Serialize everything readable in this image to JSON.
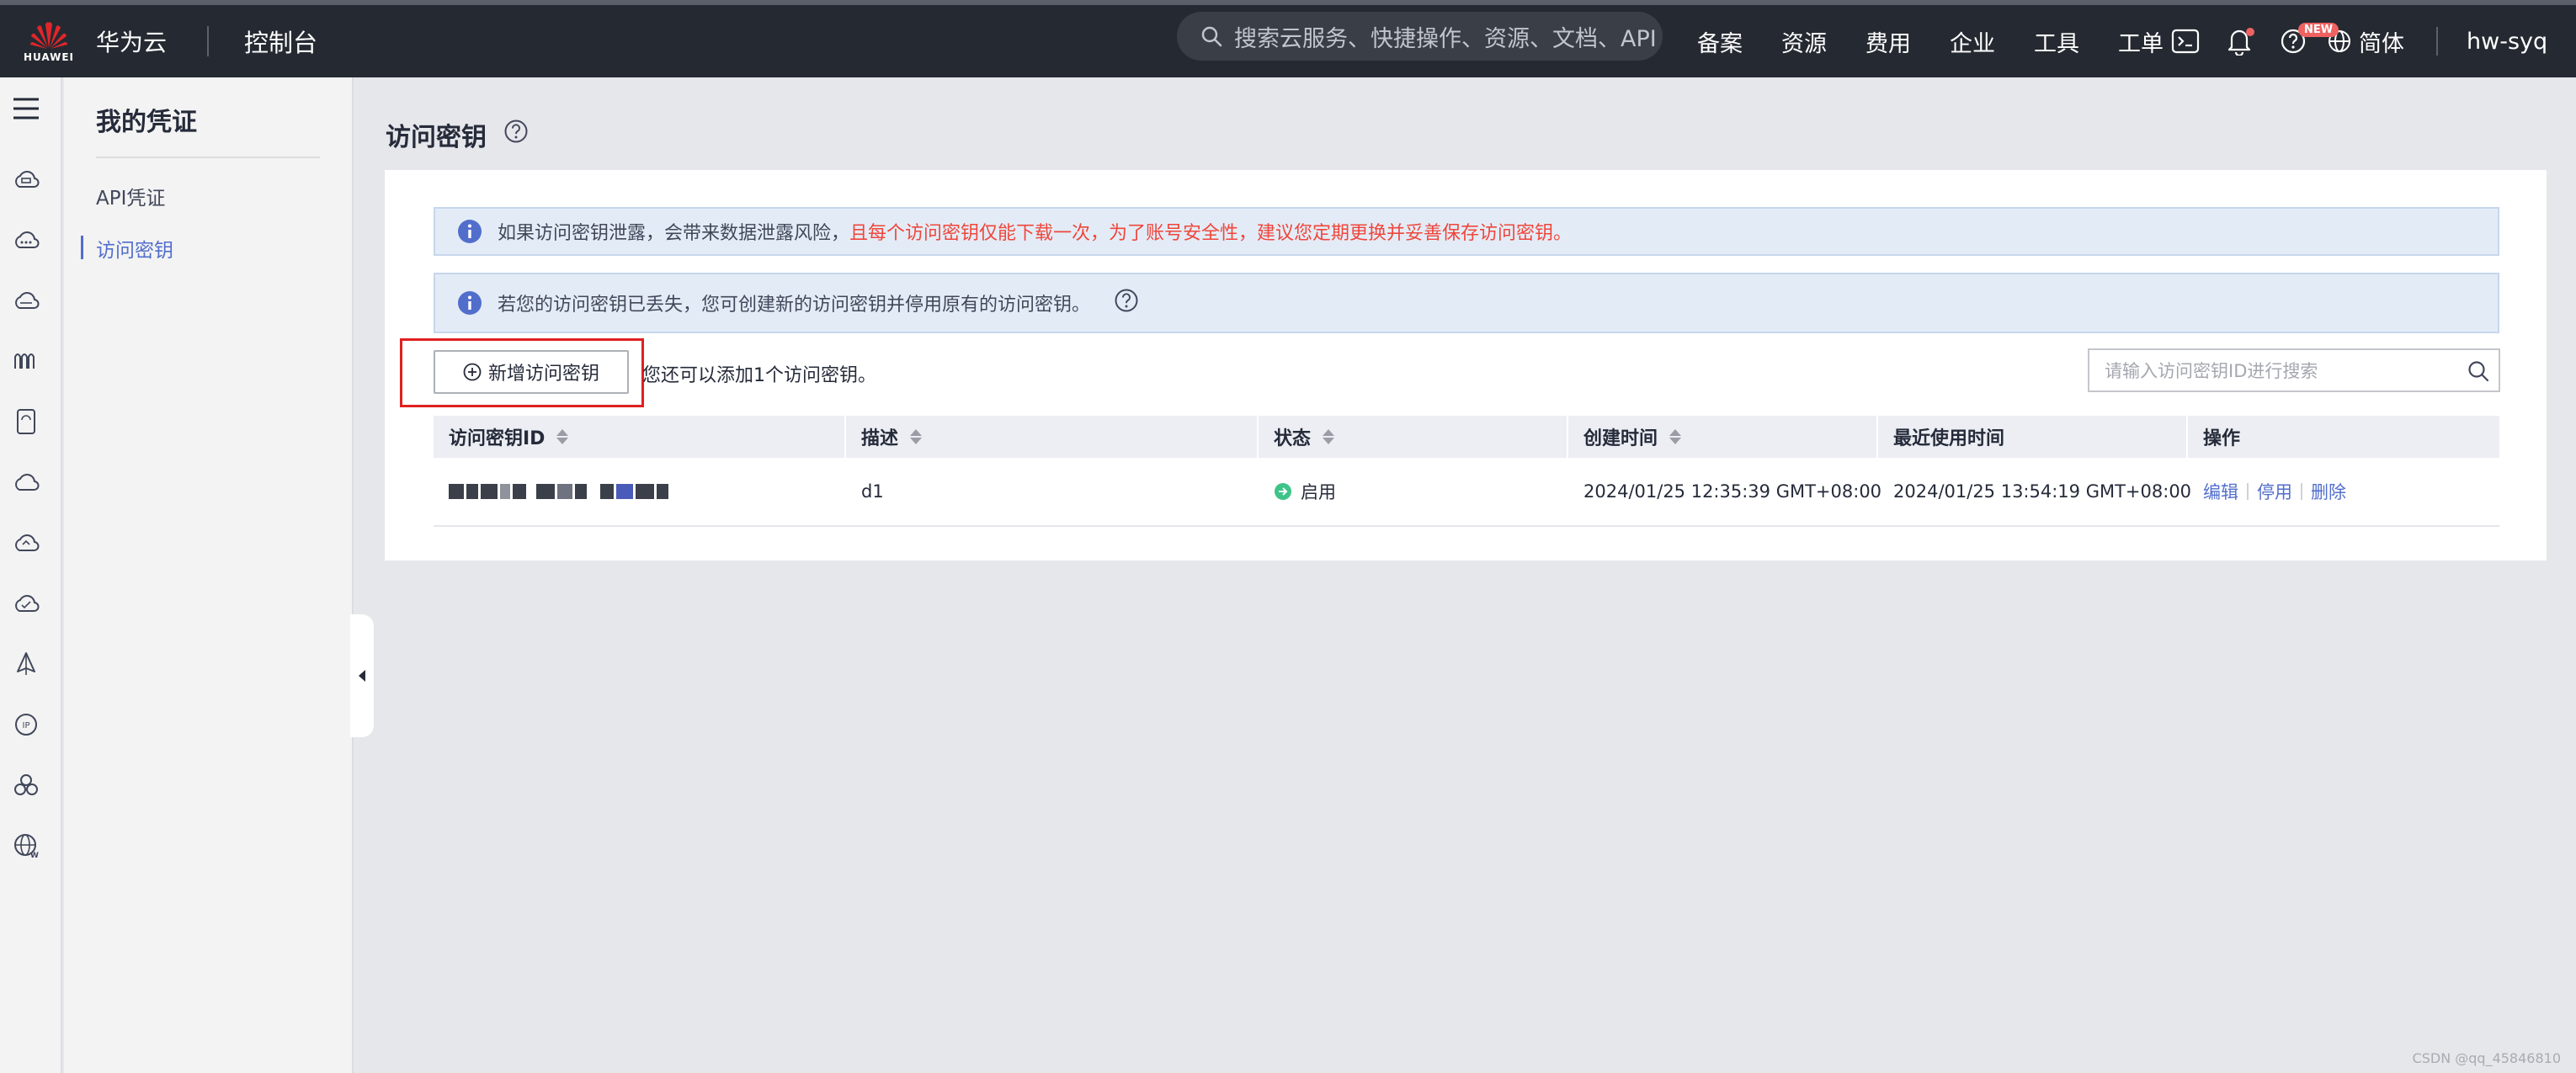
{
  "topbar": {
    "logo_text": "HUAWEI",
    "brand": "华为云",
    "console": "控制台",
    "search_placeholder": "搜索云服务、快捷操作、资源、文档、API",
    "nav": [
      "备案",
      "资源",
      "费用",
      "企业",
      "工具",
      "工单"
    ],
    "new_badge": "NEW",
    "language": "简体",
    "user": "hw-syq"
  },
  "subnav": {
    "title": "我的凭证",
    "items": [
      {
        "label": "API凭证",
        "active": false
      },
      {
        "label": "访问密钥",
        "active": true
      }
    ]
  },
  "page": {
    "title": "访问密钥"
  },
  "notices": {
    "first_normal": "如果访问密钥泄露，会带来数据泄露风险，",
    "first_warning": "且每个访问密钥仅能下载一次，为了账号安全性，建议您定期更换并妥善保存访问密钥。",
    "second": "若您的访问密钥已丢失，您可创建新的访问密钥并停用原有的访问密钥。"
  },
  "toolbar": {
    "add_button": "新增访问密钥",
    "add_hint": "您还可以添加1个访问密钥。",
    "search_placeholder": "请输入访问密钥ID进行搜索"
  },
  "table": {
    "columns": [
      "访问密钥ID",
      "描述",
      "状态",
      "创建时间",
      "最近使用时间",
      "操作"
    ],
    "rows": [
      {
        "description": "d1",
        "status": "启用",
        "created": "2024/01/25 12:35:39 GMT+08:00",
        "last_used": "2024/01/25 13:54:19 GMT+08:00",
        "actions": [
          "编辑",
          "停用",
          "删除"
        ]
      }
    ]
  },
  "watermark": "CSDN @qq_45846810",
  "colors": {
    "topbar": "#252a32",
    "accent": "#526ecc",
    "warning": "#f0463c",
    "highlight_box": "#e02020",
    "status_ok": "#3ec488"
  },
  "icons": [
    "huawei-logo-icon",
    "search-icon",
    "terminal-icon",
    "bell-icon",
    "help-icon",
    "globe-icon",
    "menu-icon",
    "info-icon",
    "plus-circle-icon",
    "sort-icon",
    "status-arrow-icon",
    "collapse-arrow-icon"
  ]
}
